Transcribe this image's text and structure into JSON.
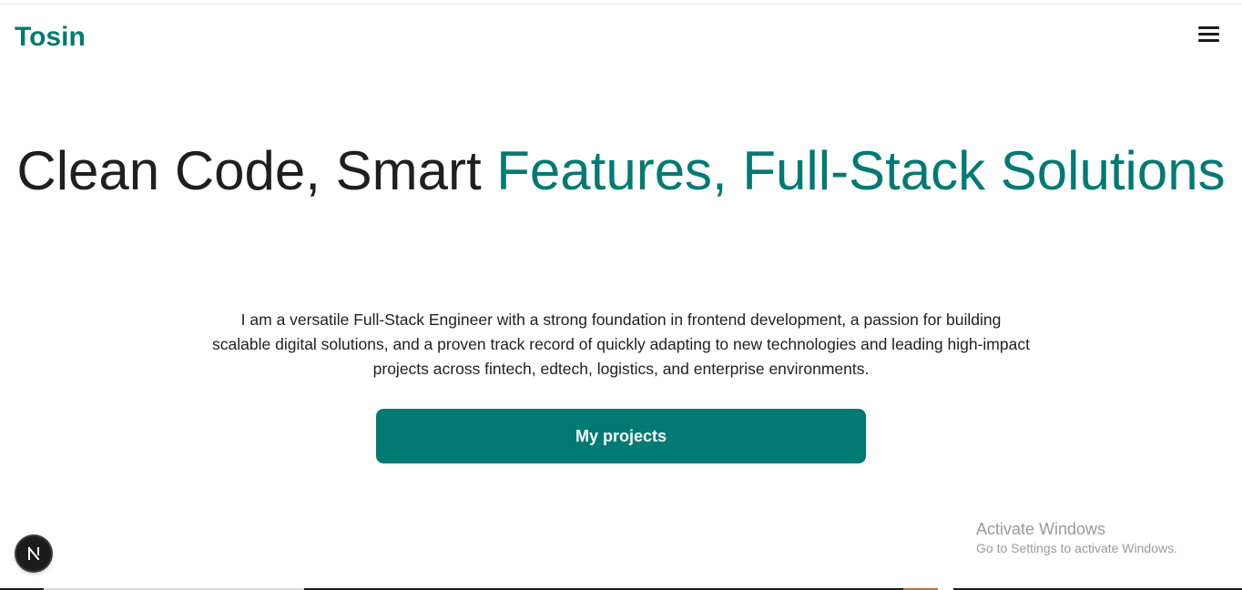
{
  "header": {
    "brand": "Tosin",
    "menu_icon": "hamburger-menu-icon"
  },
  "hero": {
    "title_part1": "Clean Code, Smart ",
    "title_part2": "Features, Full-Stack Solutions",
    "description": "I am a versatile Full-Stack Engineer with a strong foundation in frontend development, a passion for building scalable digital solutions, and a proven track record of quickly adapting to new technologies and leading high-impact projects across fintech, edtech, logistics, and enterprise environments.",
    "cta_label": "My projects"
  },
  "dev_indicator": {
    "icon": "nextjs-logo-icon",
    "letter": "N"
  },
  "watermark": {
    "title": "Activate Windows",
    "subtitle": "Go to Settings to activate Windows."
  },
  "colors": {
    "accent": "#007a73",
    "text": "#1f1f1f",
    "watermark": "#9a9a9a"
  }
}
